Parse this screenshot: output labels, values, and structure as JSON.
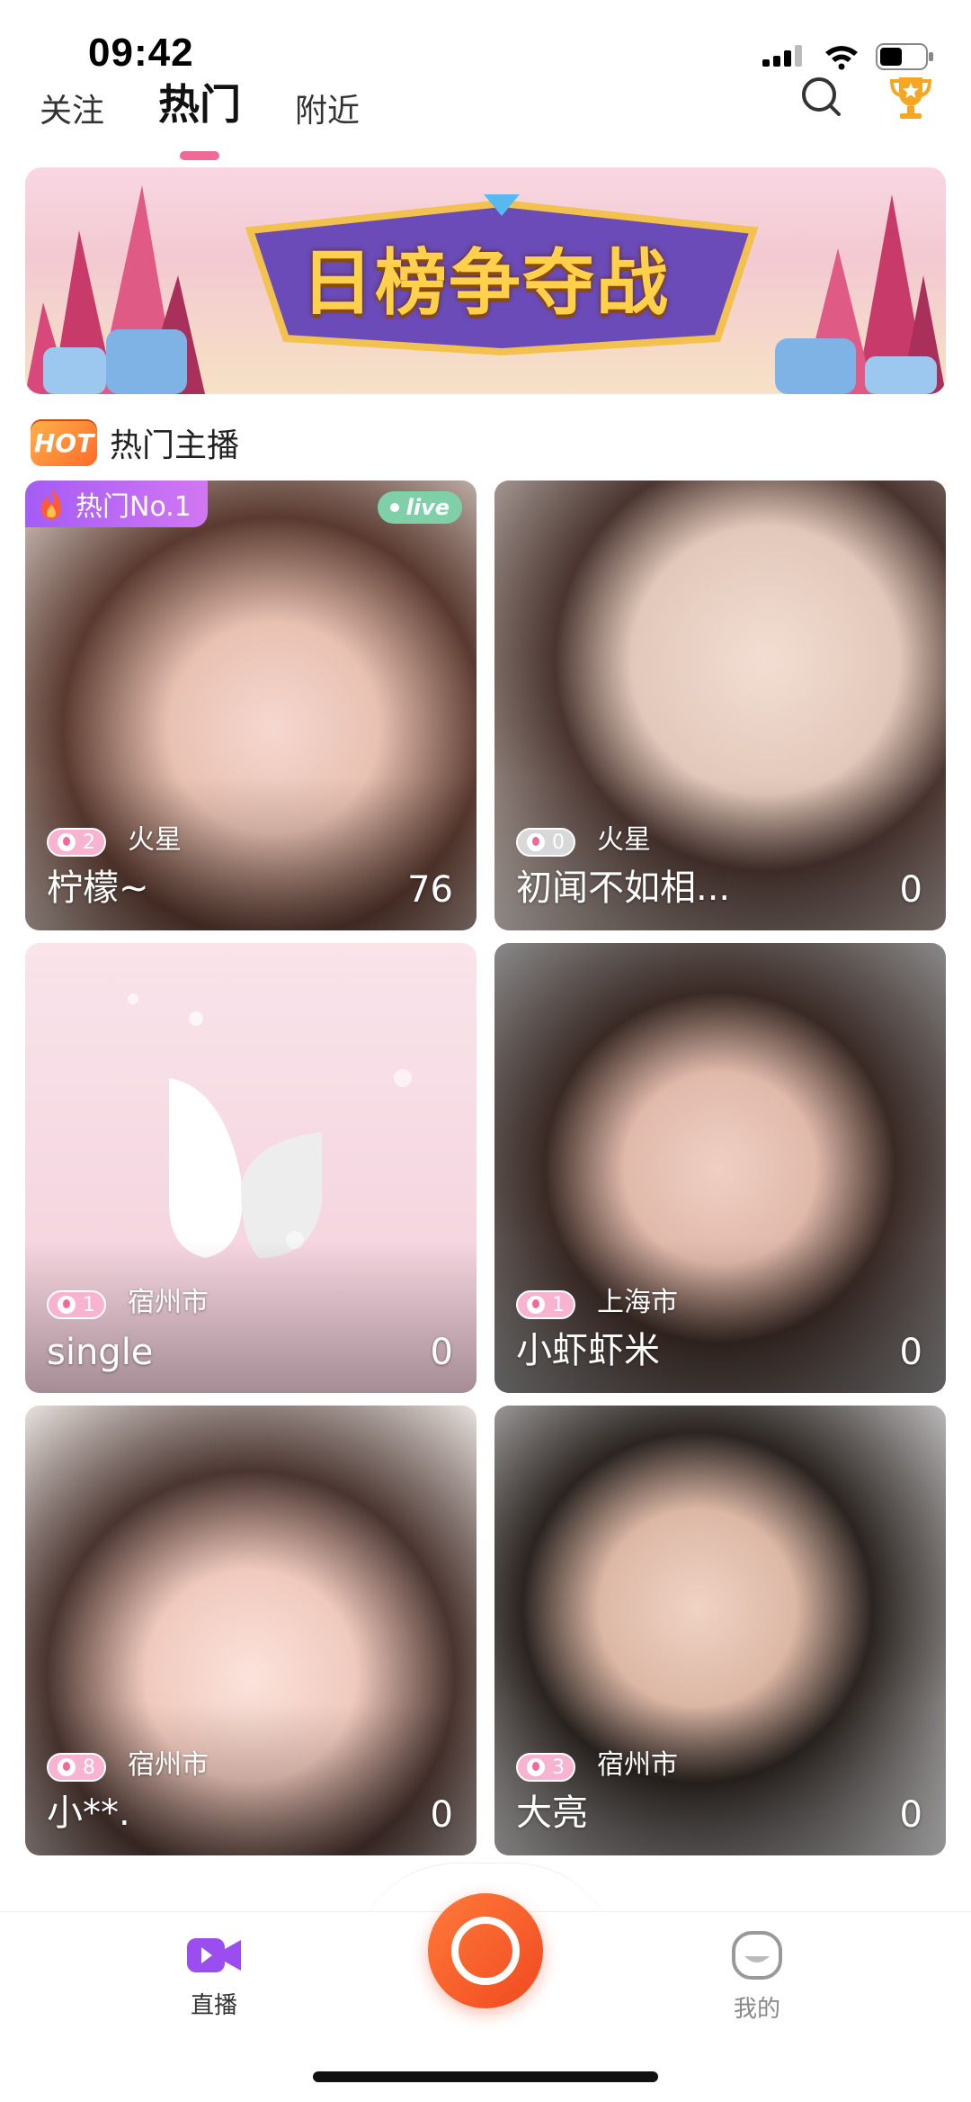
{
  "status_bar": {
    "time": "09:42"
  },
  "top_tabs": [
    {
      "label": "关注",
      "active": false
    },
    {
      "label": "热门",
      "active": true
    },
    {
      "label": "附近",
      "active": false
    }
  ],
  "banner": {
    "title": "日榜争夺战"
  },
  "section": {
    "badge": "HOT",
    "title": "热门主播"
  },
  "rank_badge": "热门No.1",
  "live_badge": "live",
  "cards": [
    {
      "level": "2",
      "location": "火星",
      "name": "柠檬~",
      "count": "76"
    },
    {
      "level": "0",
      "location": "火星",
      "name": "初闻不如相...",
      "count": "0"
    },
    {
      "level": "1",
      "location": "宿州市",
      "name": "single",
      "count": "0"
    },
    {
      "level": "1",
      "location": "上海市",
      "name": "小虾虾米",
      "count": "0"
    },
    {
      "level": "8",
      "location": "宿州市",
      "name": "小**.",
      "count": "0"
    },
    {
      "level": "3",
      "location": "宿州市",
      "name": "大亮",
      "count": "0"
    }
  ],
  "bottom_nav": {
    "live_label": "直播",
    "mine_label": "我的"
  },
  "colors": {
    "accent_pink": "#f06a97",
    "record_orange": "#f0491f",
    "nav_purple": "#9b4df0"
  },
  "icons": [
    "signal-icon",
    "wifi-icon",
    "battery-icon",
    "search-icon",
    "trophy-icon",
    "fire-icon",
    "video-camera-icon",
    "profile-icon",
    "record-icon"
  ]
}
